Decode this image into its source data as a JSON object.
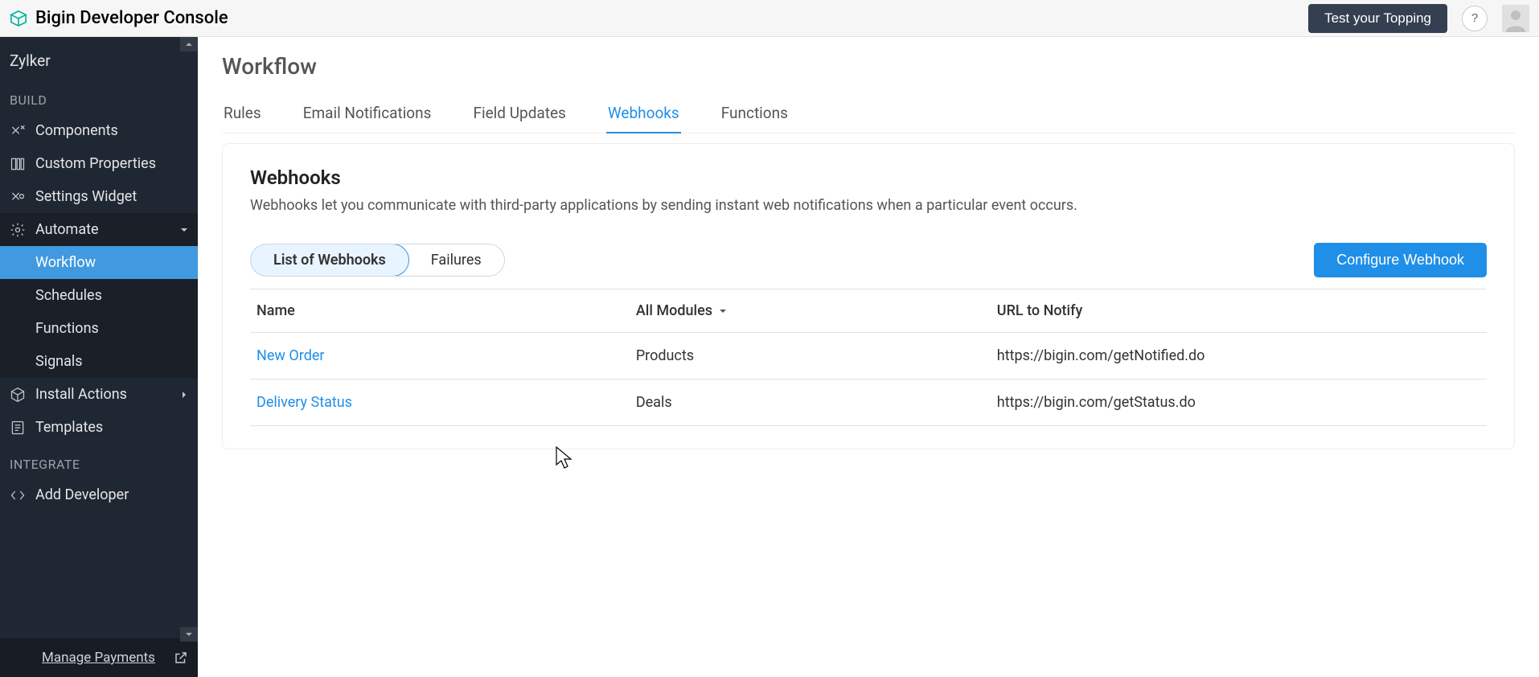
{
  "header": {
    "title": "Bigin Developer Console",
    "test_button": "Test your Topping",
    "help": "?"
  },
  "sidebar": {
    "org": "Zylker",
    "sections": {
      "build": "BUILD",
      "integrate": "INTEGRATE"
    },
    "items": {
      "components": "Components",
      "custom_properties": "Custom Properties",
      "settings_widget": "Settings Widget",
      "automate": "Automate",
      "install_actions": "Install Actions",
      "templates": "Templates",
      "add_developer": "Add Developer"
    },
    "automate_sub": {
      "workflow": "Workflow",
      "schedules": "Schedules",
      "functions": "Functions",
      "signals": "Signals"
    },
    "footer": "Manage Payments"
  },
  "main": {
    "title": "Workflow",
    "tabs": {
      "rules": "Rules",
      "email": "Email Notifications",
      "field": "Field Updates",
      "webhooks": "Webhooks",
      "functions": "Functions"
    },
    "card": {
      "title": "Webhooks",
      "desc": "Webhooks let you communicate with third-party applications by sending instant web notifications when a particular event occurs."
    },
    "pills": {
      "list": "List of Webhooks",
      "failures": "Failures"
    },
    "configure_button": "Configure Webhook",
    "columns": {
      "name": "Name",
      "modules": "All Modules",
      "url": "URL to Notify"
    },
    "rows": [
      {
        "name": "New Order",
        "module": "Products",
        "url": "https://bigin.com/getNotified.do"
      },
      {
        "name": "Delivery Status",
        "module": "Deals",
        "url": "https://bigin.com/getStatus.do"
      }
    ]
  }
}
